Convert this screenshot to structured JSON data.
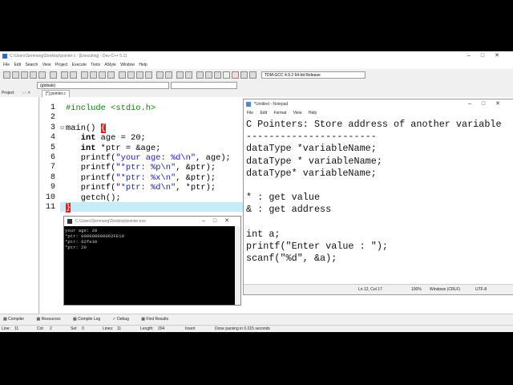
{
  "devcpp": {
    "title": "C:\\Users\\Semnang\\Desktop\\pointer.c - [Executing] - Dev-C++ 5.11",
    "menu": [
      "File",
      "Edit",
      "Search",
      "View",
      "Project",
      "Execute",
      "Tools",
      "AStyle",
      "Window",
      "Help"
    ],
    "compiler_select": "TDM-GCC 4.9.2 64-bit Release",
    "scope_select": "(globals)",
    "project_tab": "Project",
    "file_tab": "[*] pointer.c",
    "line_numbers": [
      "1",
      "2",
      "3",
      "4",
      "5",
      "6",
      "7",
      "8",
      "9",
      "10",
      "11"
    ],
    "bottom_tabs": [
      "Compiler",
      "Resources",
      "Compile Log",
      "Debug",
      "Find Results"
    ],
    "status": {
      "line_label": "Line:",
      "line": "11",
      "col_label": "Col:",
      "col": "2",
      "sel_label": "Sel:",
      "sel": "0",
      "lines_label": "Lines:",
      "lines": "11",
      "length_label": "Length:",
      "length": "204",
      "mode": "Insert",
      "message": "Done parsing in 0.015 seconds"
    }
  },
  "console": {
    "title": "C:\\Users\\Semnang\\Desktop\\pointer.exe",
    "output": [
      "your age: 20",
      "*ptr: 000000000062FE10",
      "*ptr: 62fe10",
      "*ptr: 20"
    ]
  },
  "notepad": {
    "title": "*Untitled - Notepad",
    "menu": [
      "File",
      "Edit",
      "Format",
      "View",
      "Help"
    ],
    "lines": [
      "C Pointers: Store address of another variable",
      "-----------------------",
      "dataType *variableName;",
      "dataType * variableName;",
      "dataType* variableName;",
      "",
      "* : get value",
      "& : get address",
      "",
      "int a;",
      "printf(\"Enter value : \");",
      "scanf(\"%d\", &a);"
    ],
    "status": {
      "position": "Ln 12, Col 17",
      "zoom": "100%",
      "eol": "Windows (CRLF)",
      "encoding": "UTF-8"
    }
  },
  "colors": {
    "string": "#1f21b0",
    "preprocessor": "#127a12",
    "brace_highlight": "#e02020",
    "current_line": "#c8ecf7"
  }
}
